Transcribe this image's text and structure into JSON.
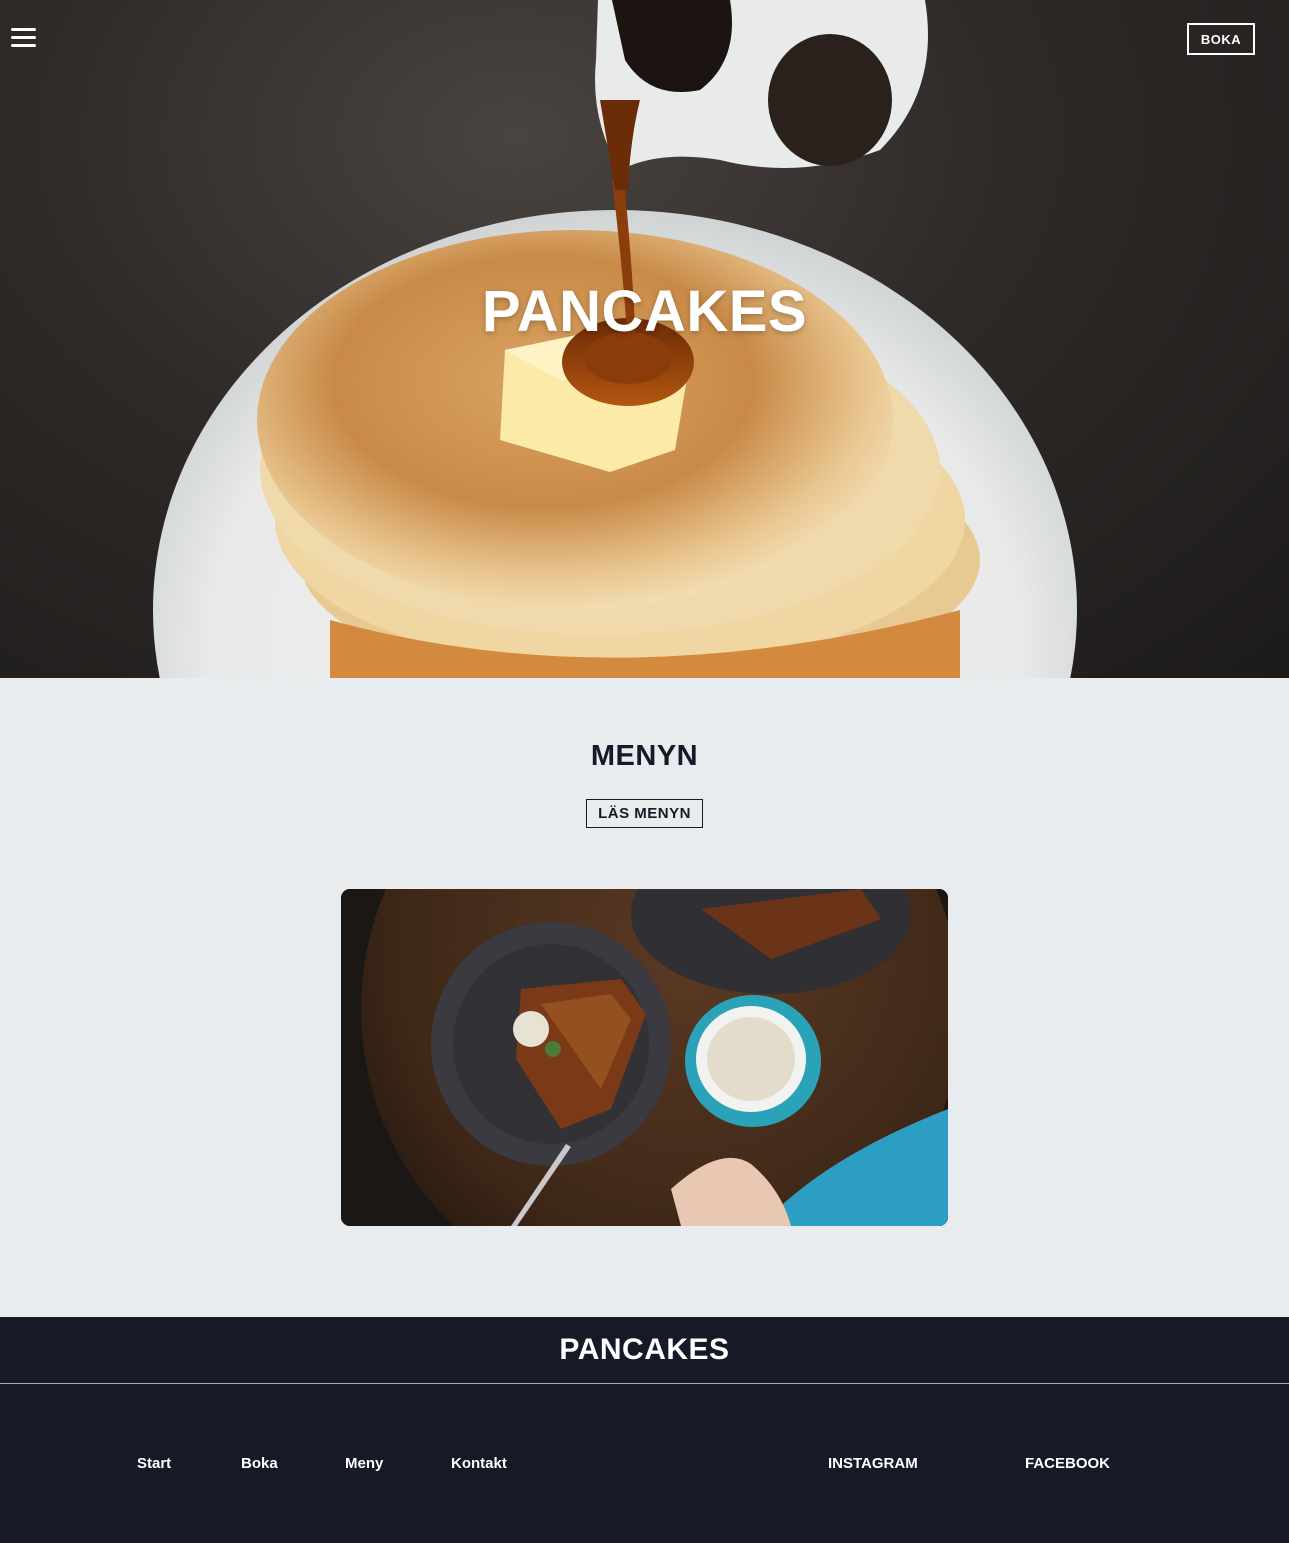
{
  "header": {
    "menu_icon": "hamburger-menu-icon",
    "book_label": "BOKA"
  },
  "hero": {
    "title": "PANCAKES",
    "image": "pancakes-with-syrup-photo"
  },
  "menu_section": {
    "title": "MENYN",
    "button_label": "LÄS MENYN",
    "image": "waffles-and-coffee-photo"
  },
  "footer": {
    "brand": "PANCAKES",
    "nav": [
      "Start",
      "Boka",
      "Meny",
      "Kontakt"
    ],
    "social": [
      "INSTAGRAM",
      "FACEBOOK"
    ]
  },
  "colors": {
    "dark_navy": "#161a27",
    "light_bg": "#e9ecef",
    "white": "#ffffff"
  }
}
